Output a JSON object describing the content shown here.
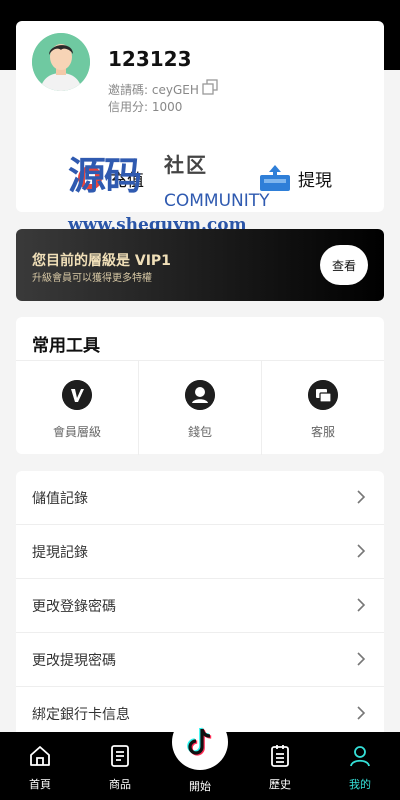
{
  "profile": {
    "username": "123123",
    "invite_text": "邀請碼: ceyGEH",
    "credit_text": "信用分: 1000",
    "deposit_label": "充值",
    "withdraw_label": "提現"
  },
  "watermark": {
    "big": "源码",
    "small": "社区",
    "community": "COMMUNITY",
    "url": "www.shequym.com"
  },
  "vip": {
    "title": "您目前的層級是 VIP1",
    "subtitle": "升級會員可以獲得更多特權",
    "view_label": "查看"
  },
  "tools": {
    "title": "常用工具",
    "items": [
      {
        "label": "會員層級",
        "icon": "v-badge-icon"
      },
      {
        "label": "錢包",
        "icon": "user-icon"
      },
      {
        "label": "客服",
        "icon": "chat-icon"
      }
    ]
  },
  "menu": {
    "items": [
      {
        "label": "儲值記錄"
      },
      {
        "label": "提現記錄"
      },
      {
        "label": "更改登錄密碼"
      },
      {
        "label": "更改提現密碼"
      },
      {
        "label": "綁定銀行卡信息"
      }
    ]
  },
  "nav": {
    "items": [
      {
        "label": "首頁",
        "icon": "home-icon"
      },
      {
        "label": "商品",
        "icon": "document-icon"
      },
      {
        "label": "開始",
        "icon": "tiktok-icon"
      },
      {
        "label": "歷史",
        "icon": "list-icon"
      },
      {
        "label": "我的",
        "icon": "profile-icon"
      }
    ],
    "active": "我的",
    "active_color": "#35e0d8"
  }
}
